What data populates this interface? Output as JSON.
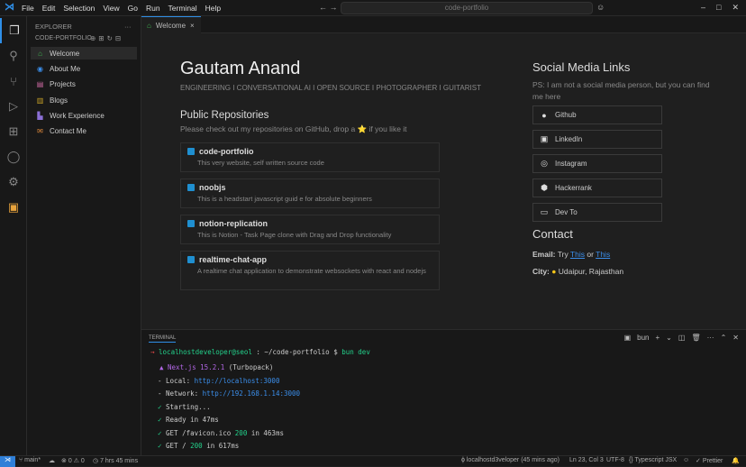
{
  "titlebar": {
    "menu": [
      "File",
      "Edit",
      "Selection",
      "View",
      "Go",
      "Run",
      "Terminal",
      "Help"
    ],
    "search": "code-portfolio",
    "nav": "← →"
  },
  "sidebar": {
    "header": "EXPLORER",
    "folder": "CODE-PORTFOLIO",
    "items": [
      {
        "label": "Welcome",
        "icon": "home-icon",
        "color": "#3fb950"
      },
      {
        "label": "About Me",
        "icon": "user-icon",
        "color": "#3b8eea"
      },
      {
        "label": "Projects",
        "icon": "briefcase-icon",
        "color": "#d16ba5"
      },
      {
        "label": "Blogs",
        "icon": "book-icon",
        "color": "#c9a227"
      },
      {
        "label": "Work Experience",
        "icon": "building-icon",
        "color": "#8b6fd6"
      },
      {
        "label": "Contact Me",
        "icon": "mail-icon",
        "color": "#e08a3c"
      }
    ]
  },
  "tab": {
    "label": "Welcome",
    "close": "×"
  },
  "main": {
    "name": "Gautam Anand",
    "tagline": "ENGINEERING I CONVERSATIONAL AI I OPEN SOURCE I PHOTOGRAPHER I GUITARIST",
    "repos_title": "Public Repositories",
    "repos_sub": "Please check out my repositories on GitHub, drop a ⭐ if you like it",
    "repos": [
      {
        "name": "code-portfolio",
        "desc": "This very website, self written source code"
      },
      {
        "name": "noobjs",
        "desc": "This is a headstart javascript guid e for absolute beginners"
      },
      {
        "name": "notion-replication",
        "desc": "This is Notion - Task Page clone with Drag and Drop functionality"
      },
      {
        "name": "realtime-chat-app",
        "desc": "A realtime chat application to demonstrate websockets with react and nodejs"
      }
    ],
    "social_title": "Social Media Links",
    "social_sub": "PS: I am not a social media person, but you can find me here",
    "social": [
      {
        "label": "Github",
        "icon": "github-icon"
      },
      {
        "label": "LinkedIn",
        "icon": "linkedin-icon"
      },
      {
        "label": "Instagram",
        "icon": "instagram-icon"
      },
      {
        "label": "Hackerrank",
        "icon": "hackerrank-icon"
      },
      {
        "label": "Dev To",
        "icon": "devto-icon"
      }
    ],
    "contact_title": "Contact",
    "email_label": "Email:",
    "email_try": "Try",
    "email_link1": "This",
    "email_or": "or",
    "email_link2": "This",
    "city_label": "City:",
    "city": "Udaipur, Rajasthan"
  },
  "terminal": {
    "title": "TERMINAL",
    "shell": "bun",
    "prompt_user": "localhostdeveloper@seol",
    "prompt_path": ": ~/code-portfolio $",
    "prompt_cmd": "bun dev",
    "next": "▲ Next.js 15.2.1",
    "turbo": "(Turbopack)",
    "local_label": "- Local:",
    "local_url": "http://localhost:3000",
    "network_label": "- Network:",
    "network_url": "http://192.168.1.14:3000",
    "starting": "Starting...",
    "ready": "Ready in 47ms",
    "get1_a": "GET /favicon.ico",
    "get1_code": "200",
    "get1_b": "in 463ms",
    "get2_a": "GET /",
    "get2_code": "200",
    "get2_b": "in 617ms"
  },
  "status": {
    "branch": "main*",
    "errors": "0",
    "warnings": "0",
    "time": "7 hrs 45 mins",
    "author": "localhostd3veloper (45 mins ago)",
    "position": "Ln 23, Col 3",
    "encoding": "UTF-8",
    "language": "Typescript JSX",
    "formatter": "Prettier"
  }
}
